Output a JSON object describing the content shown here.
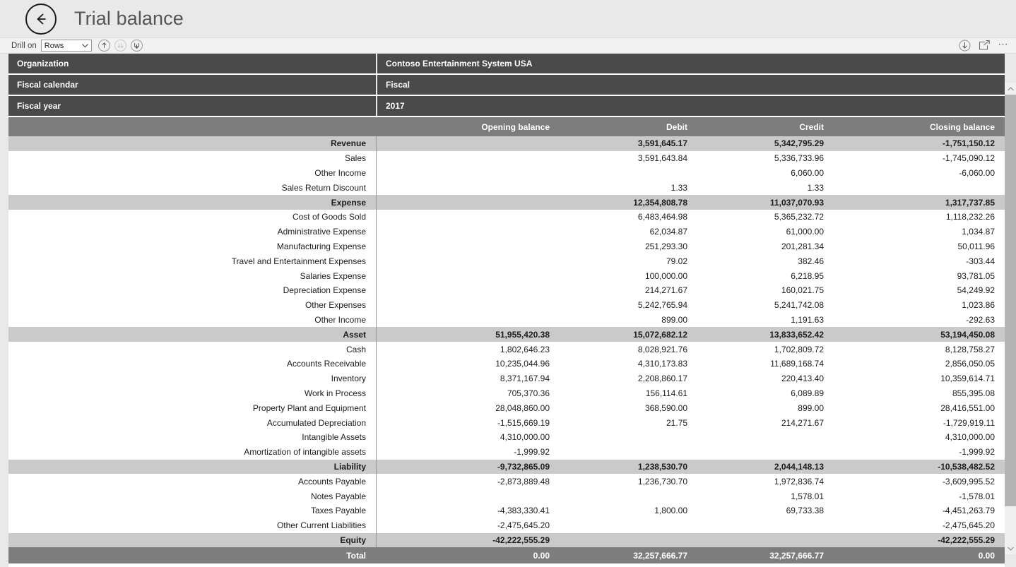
{
  "header": {
    "back_icon": "back-arrow-circle-icon",
    "title": "Trial balance"
  },
  "toolbar": {
    "drill_on_label": "Drill on",
    "drill_on_value": "Rows",
    "drill_up_icon": "drill-up-icon",
    "drill_down_icon": "drill-down-icon",
    "expand_all_icon": "expand-all-down-icon",
    "drill_mode_icon": "drill-mode-icon",
    "focus_mode_icon": "focus-mode-icon",
    "more_options_icon": "more-options-ellipsis-icon"
  },
  "filters": [
    {
      "label": "Organization",
      "value": "Contoso Entertainment System USA"
    },
    {
      "label": "Fiscal calendar",
      "value": "Fiscal"
    },
    {
      "label": "Fiscal year",
      "value": "2017"
    }
  ],
  "table": {
    "columns": [
      "",
      "Opening balance",
      "Debit",
      "Credit",
      "Closing balance"
    ],
    "rows": [
      {
        "type": "group",
        "label": "Revenue",
        "opening": "",
        "debit": "3,591,645.17",
        "credit": "5,342,795.29",
        "closing": "-1,751,150.12"
      },
      {
        "type": "detail",
        "label": "Sales",
        "opening": "",
        "debit": "3,591,643.84",
        "credit": "5,336,733.96",
        "closing": "-1,745,090.12"
      },
      {
        "type": "detail",
        "label": "Other Income",
        "opening": "",
        "debit": "",
        "credit": "6,060.00",
        "closing": "-6,060.00"
      },
      {
        "type": "detail",
        "label": "Sales Return Discount",
        "opening": "",
        "debit": "1.33",
        "credit": "1.33",
        "closing": ""
      },
      {
        "type": "group",
        "label": "Expense",
        "opening": "",
        "debit": "12,354,808.78",
        "credit": "11,037,070.93",
        "closing": "1,317,737.85"
      },
      {
        "type": "detail",
        "label": "Cost of Goods Sold",
        "opening": "",
        "debit": "6,483,464.98",
        "credit": "5,365,232.72",
        "closing": "1,118,232.26"
      },
      {
        "type": "detail",
        "label": "Administrative Expense",
        "opening": "",
        "debit": "62,034.87",
        "credit": "61,000.00",
        "closing": "1,034.87"
      },
      {
        "type": "detail",
        "label": "Manufacturing Expense",
        "opening": "",
        "debit": "251,293.30",
        "credit": "201,281.34",
        "closing": "50,011.96"
      },
      {
        "type": "detail",
        "label": "Travel and Entertainment Expenses",
        "opening": "",
        "debit": "79.02",
        "credit": "382.46",
        "closing": "-303.44"
      },
      {
        "type": "detail",
        "label": "Salaries Expense",
        "opening": "",
        "debit": "100,000.00",
        "credit": "6,218.95",
        "closing": "93,781.05"
      },
      {
        "type": "detail",
        "label": "Depreciation Expense",
        "opening": "",
        "debit": "214,271.67",
        "credit": "160,021.75",
        "closing": "54,249.92"
      },
      {
        "type": "detail",
        "label": "Other Expenses",
        "opening": "",
        "debit": "5,242,765.94",
        "credit": "5,241,742.08",
        "closing": "1,023.86"
      },
      {
        "type": "detail",
        "label": "Other Income",
        "opening": "",
        "debit": "899.00",
        "credit": "1,191.63",
        "closing": "-292.63"
      },
      {
        "type": "group",
        "label": "Asset",
        "opening": "51,955,420.38",
        "debit": "15,072,682.12",
        "credit": "13,833,652.42",
        "closing": "53,194,450.08"
      },
      {
        "type": "detail",
        "label": "Cash",
        "opening": "1,802,646.23",
        "debit": "8,028,921.76",
        "credit": "1,702,809.72",
        "closing": "8,128,758.27"
      },
      {
        "type": "detail",
        "label": "Accounts Receivable",
        "opening": "10,235,044.96",
        "debit": "4,310,173.83",
        "credit": "11,689,168.74",
        "closing": "2,856,050.05"
      },
      {
        "type": "detail",
        "label": "Inventory",
        "opening": "8,371,167.94",
        "debit": "2,208,860.17",
        "credit": "220,413.40",
        "closing": "10,359,614.71"
      },
      {
        "type": "detail",
        "label": "Work in Process",
        "opening": "705,370.36",
        "debit": "156,114.61",
        "credit": "6,089.89",
        "closing": "855,395.08"
      },
      {
        "type": "detail",
        "label": "Property Plant and Equipment",
        "opening": "28,048,860.00",
        "debit": "368,590.00",
        "credit": "899.00",
        "closing": "28,416,551.00"
      },
      {
        "type": "detail",
        "label": "Accumulated Depreciation",
        "opening": "-1,515,669.19",
        "debit": "21.75",
        "credit": "214,271.67",
        "closing": "-1,729,919.11"
      },
      {
        "type": "detail",
        "label": "Intangible Assets",
        "opening": "4,310,000.00",
        "debit": "",
        "credit": "",
        "closing": "4,310,000.00"
      },
      {
        "type": "detail",
        "label": "Amortization of intangible assets",
        "opening": "-1,999.92",
        "debit": "",
        "credit": "",
        "closing": "-1,999.92"
      },
      {
        "type": "group",
        "label": "Liability",
        "opening": "-9,732,865.09",
        "debit": "1,238,530.70",
        "credit": "2,044,148.13",
        "closing": "-10,538,482.52"
      },
      {
        "type": "detail",
        "label": "Accounts Payable",
        "opening": "-2,873,889.48",
        "debit": "1,236,730.70",
        "credit": "1,972,836.74",
        "closing": "-3,609,995.52"
      },
      {
        "type": "detail",
        "label": "Notes Payable",
        "opening": "",
        "debit": "",
        "credit": "1,578.01",
        "closing": "-1,578.01"
      },
      {
        "type": "detail",
        "label": "Taxes Payable",
        "opening": "-4,383,330.41",
        "debit": "1,800.00",
        "credit": "69,733.38",
        "closing": "-4,451,263.79"
      },
      {
        "type": "detail",
        "label": "Other Current Liabilities",
        "opening": "-2,475,645.20",
        "debit": "",
        "credit": "",
        "closing": "-2,475,645.20"
      },
      {
        "type": "group",
        "label": "Equity",
        "opening": "-42,222,555.29",
        "debit": "",
        "credit": "",
        "closing": "-42,222,555.29"
      },
      {
        "type": "total",
        "label": "Total",
        "opening": "0.00",
        "debit": "32,257,666.77",
        "credit": "32,257,666.77",
        "closing": "0.00"
      }
    ]
  },
  "scrollbar": {
    "up_icon": "chevron-up-icon",
    "down_icon": "chevron-down-icon"
  }
}
